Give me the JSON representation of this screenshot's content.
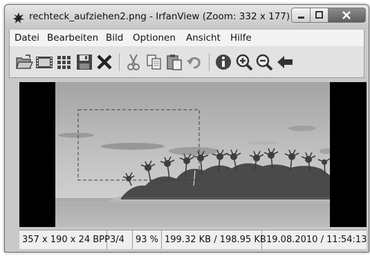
{
  "window": {
    "title": "rechteck_aufziehen2.png - IrfanView (Zoom: 332 x 177)"
  },
  "menu": [
    "Datei",
    "Bearbeiten",
    "Bild",
    "Optionen",
    "Ansicht",
    "Hilfe"
  ],
  "toolbar_icons": [
    "open-folder",
    "slideshow",
    "thumbnails",
    "save",
    "delete",
    "cut",
    "copy",
    "paste",
    "undo",
    "info",
    "zoom-in",
    "zoom-out",
    "previous"
  ],
  "image": {
    "selection_rectangle": "dashed"
  },
  "status": {
    "dimensions": "357 x 190 x 24 BPP",
    "index": "3/4",
    "zoom": "93 %",
    "filesize": "199.32 KB / 198.95 KB",
    "datetime": "19.08.2010 / 11:54:13"
  }
}
